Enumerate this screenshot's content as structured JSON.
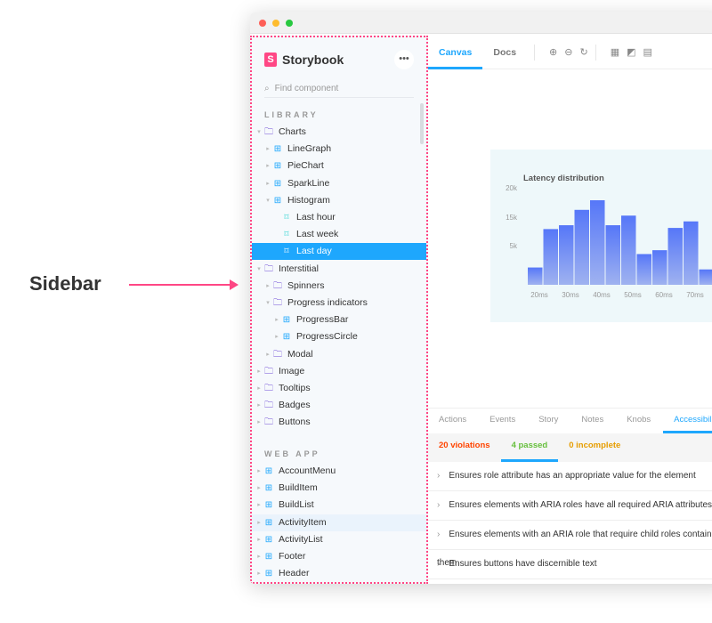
{
  "callout": {
    "label": "Sidebar"
  },
  "sidebar": {
    "brand": "Storybook",
    "more": "•••",
    "search_placeholder": "Find component",
    "sections": [
      {
        "label": "LIBRARY"
      },
      {
        "label": "WEB APP"
      }
    ],
    "library": [
      {
        "label": "Charts",
        "type": "folder",
        "depth": 0,
        "caret": "▾"
      },
      {
        "label": "LineGraph",
        "type": "component",
        "depth": 1,
        "caret": "▸"
      },
      {
        "label": "PieChart",
        "type": "component",
        "depth": 1,
        "caret": "▸"
      },
      {
        "label": "SparkLine",
        "type": "component",
        "depth": 1,
        "caret": "▸"
      },
      {
        "label": "Histogram",
        "type": "component",
        "depth": 1,
        "caret": "▾"
      },
      {
        "label": "Last hour",
        "type": "story",
        "depth": 2,
        "caret": ""
      },
      {
        "label": "Last week",
        "type": "story",
        "depth": 2,
        "caret": ""
      },
      {
        "label": "Last day",
        "type": "story",
        "depth": 2,
        "caret": "",
        "selected": true
      },
      {
        "label": "Interstitial",
        "type": "folder",
        "depth": 0,
        "caret": "▾"
      },
      {
        "label": "Spinners",
        "type": "folder",
        "depth": 1,
        "caret": "▸"
      },
      {
        "label": "Progress indicators",
        "type": "folder",
        "depth": 1,
        "caret": "▾"
      },
      {
        "label": "ProgressBar",
        "type": "component",
        "depth": 2,
        "caret": "▸"
      },
      {
        "label": "ProgressCircle",
        "type": "component",
        "depth": 2,
        "caret": "▸"
      },
      {
        "label": "Modal",
        "type": "folder",
        "depth": 1,
        "caret": "▸"
      },
      {
        "label": "Image",
        "type": "folder",
        "depth": 0,
        "caret": "▸"
      },
      {
        "label": "Tooltips",
        "type": "folder",
        "depth": 0,
        "caret": "▸"
      },
      {
        "label": "Badges",
        "type": "folder",
        "depth": 0,
        "caret": "▸"
      },
      {
        "label": "Buttons",
        "type": "folder",
        "depth": 0,
        "caret": "▸"
      }
    ],
    "webapp": [
      {
        "label": "AccountMenu",
        "type": "component",
        "depth": 0,
        "caret": "▸"
      },
      {
        "label": "BuildItem",
        "type": "component",
        "depth": 0,
        "caret": "▸"
      },
      {
        "label": "BuildList",
        "type": "component",
        "depth": 0,
        "caret": "▸"
      },
      {
        "label": "ActivityItem",
        "type": "component",
        "depth": 0,
        "caret": "▸",
        "hover": true
      },
      {
        "label": "ActivityList",
        "type": "component",
        "depth": 0,
        "caret": "▸"
      },
      {
        "label": "Footer",
        "type": "component",
        "depth": 0,
        "caret": "▸"
      },
      {
        "label": "Header",
        "type": "component",
        "depth": 0,
        "caret": "▸"
      }
    ]
  },
  "toolbar": {
    "tabs": [
      {
        "label": "Canvas",
        "active": true
      },
      {
        "label": "Docs"
      }
    ],
    "tools": [
      "zoom-in-icon",
      "zoom-out-icon",
      "zoom-reset-icon",
      "grid-icon",
      "background-icon",
      "viewport-icon"
    ]
  },
  "chart_data": {
    "type": "bar",
    "title": "Latency distribution",
    "values": [
      4500,
      14500,
      15500,
      19500,
      22000,
      15500,
      18000,
      8000,
      9000,
      14800,
      16500,
      4000
    ],
    "xtick_labels": [
      "20ms",
      "30ms",
      "40ms",
      "50ms",
      "60ms",
      "70ms"
    ],
    "ytick_labels": [
      "20k",
      "15k",
      "5k"
    ],
    "color": "#5b7cfa"
  },
  "addons": {
    "tabs": [
      {
        "label": "Actions"
      },
      {
        "label": "Events"
      },
      {
        "label": "Story"
      },
      {
        "label": "Notes"
      },
      {
        "label": "Knobs"
      },
      {
        "label": "Accessibility",
        "active": true
      }
    ],
    "subtabs": [
      {
        "label": "20 violations",
        "color": "#ff4400"
      },
      {
        "label": "4 passed",
        "color": "#66bf3c",
        "active": true
      },
      {
        "label": "0 incomplete",
        "color": "#e69d00"
      }
    ],
    "rules": [
      "Ensures role attribute has an appropriate value for the element",
      "Ensures elements with ARIA roles have all required ARIA attributes",
      "Ensures elements with an ARIA role that require child roles contain them",
      "Ensures buttons have discernible text"
    ]
  }
}
